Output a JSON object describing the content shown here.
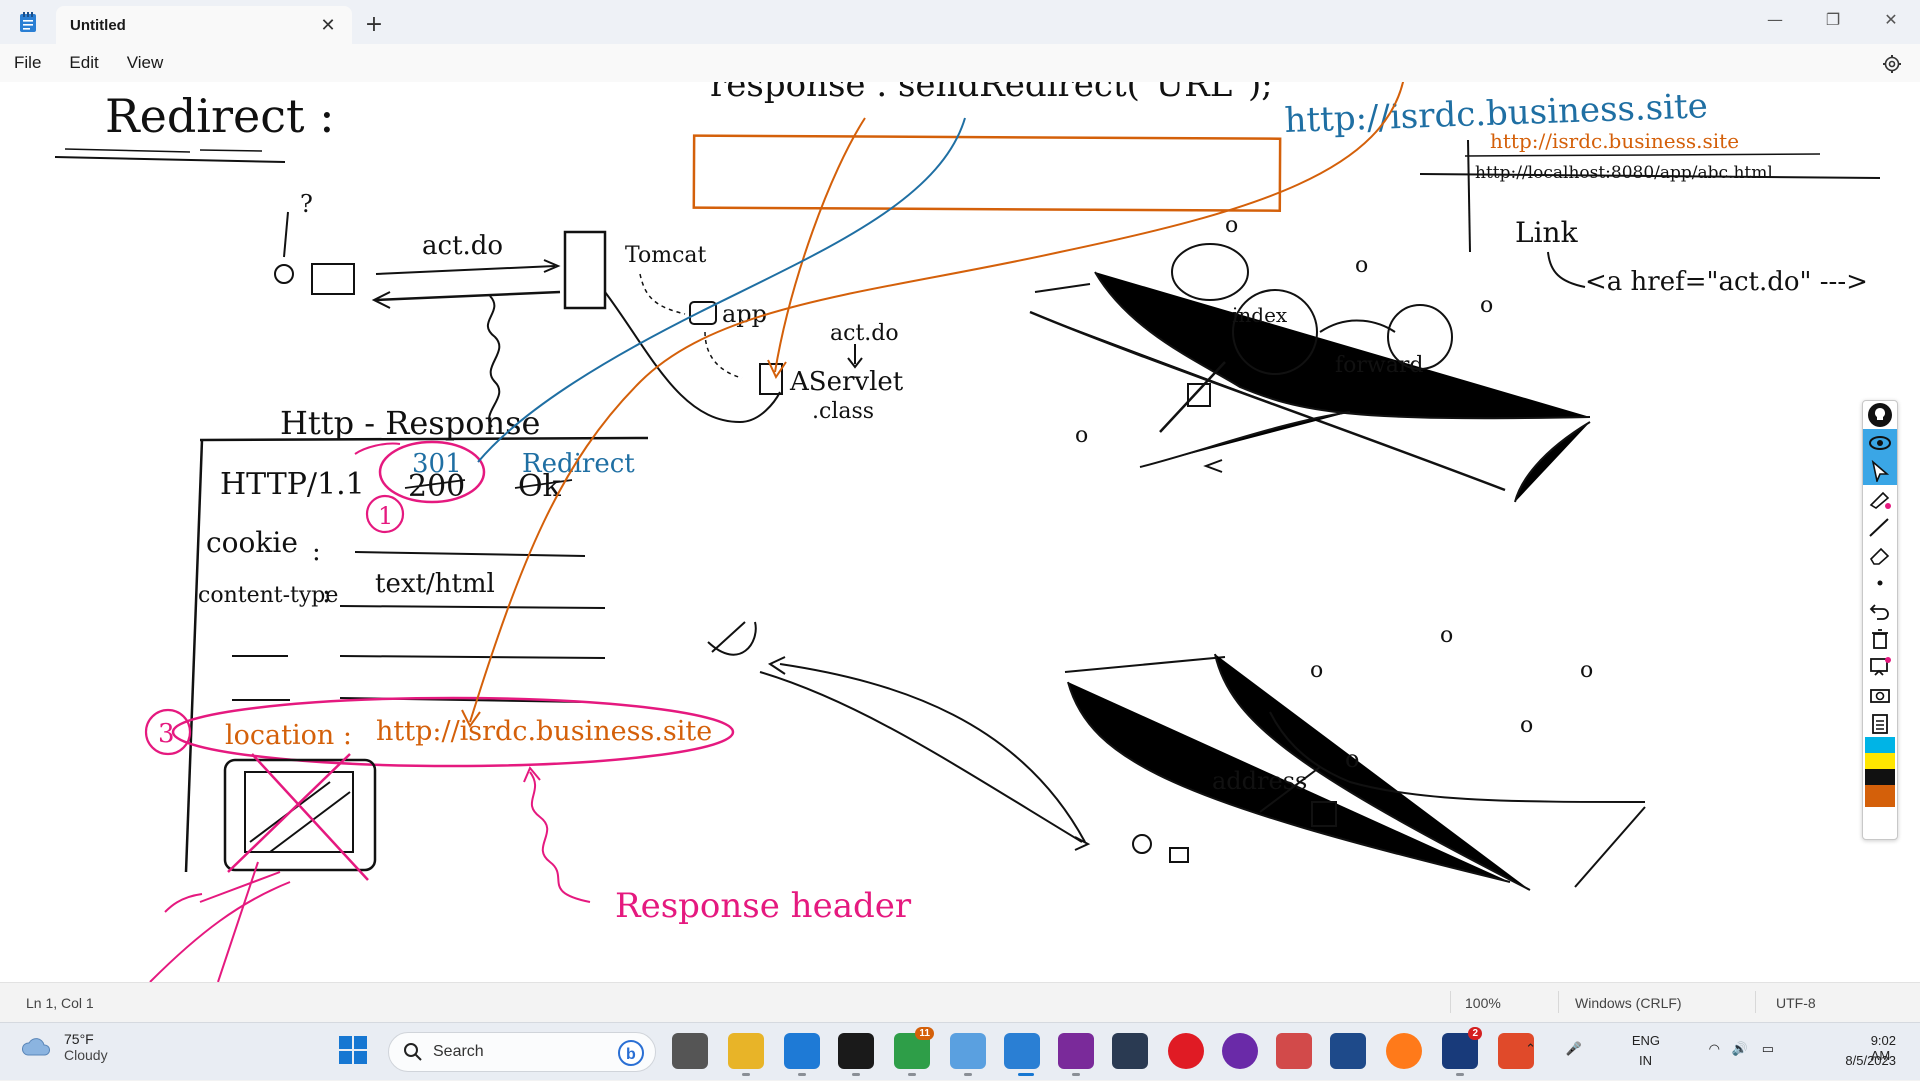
{
  "window": {
    "tab_title": "Untitled",
    "close_tab": "✕",
    "new_tab": "+",
    "minimize": "—",
    "maximize": "❐",
    "close": "✕"
  },
  "menu": {
    "file": "File",
    "edit": "Edit",
    "view": "View"
  },
  "drawing": {
    "title": "Redirect :",
    "code": "response . sendRedirect(\"URL\");",
    "url_blue": "http://isrdc.business.site",
    "url_orange_note": "http://isrdc.business.site",
    "url_localhost": "http://localhost:8080/app/abc.html",
    "link_word": "Link",
    "anchor_code": "<a href=\"act.do\" --->",
    "act_do_1": "act.do",
    "act_do_2": "act.do",
    "tomcat": "Tomcat",
    "app": "app",
    "servlet": "AServlet",
    "servlet_ext": ".class",
    "http_response": "Http - Response",
    "http_version": "HTTP/1.1",
    "status_301": "301",
    "status_200": "200",
    "redirect_word": "Redirect",
    "ok_word": "Ok",
    "cookie": "cookie",
    "content_type": "content-type",
    "content_type_value": "text/html",
    "location_label": "location :",
    "location_value": "http://isrdc.business.site",
    "circle_1": "1",
    "circle_3": "3",
    "response_header": "Response header",
    "index_word": "index",
    "forward_word": "forward",
    "address_word": "address",
    "colors": {
      "orange": "#d4600a",
      "blue": "#1f6fa3",
      "pink": "#e5197f",
      "black": "#111111"
    }
  },
  "pen_toolbar": {
    "tools": [
      "lightbulb-icon",
      "eye-icon",
      "cursor-icon",
      "highlighter-icon",
      "pen-icon",
      "eraser-icon",
      "dot",
      "undo-icon",
      "trash-icon",
      "whiteboard-icon",
      "camera-icon",
      "clipboard-icon"
    ],
    "swatches": [
      "#00b4e6",
      "#ffe600",
      "#111111",
      "#d4600a"
    ]
  },
  "status": {
    "position": "Ln 1, Col 1",
    "zoom": "100%",
    "line_ending": "Windows (CRLF)",
    "encoding": "UTF-8"
  },
  "taskbar": {
    "temperature": "75°F",
    "condition": "Cloudy",
    "search_placeholder": "Search",
    "language_1": "ENG",
    "language_2": "IN",
    "time": "9:02 AM",
    "date": "8/5/2023",
    "chrome_badge": "11",
    "word_badge": "2"
  }
}
